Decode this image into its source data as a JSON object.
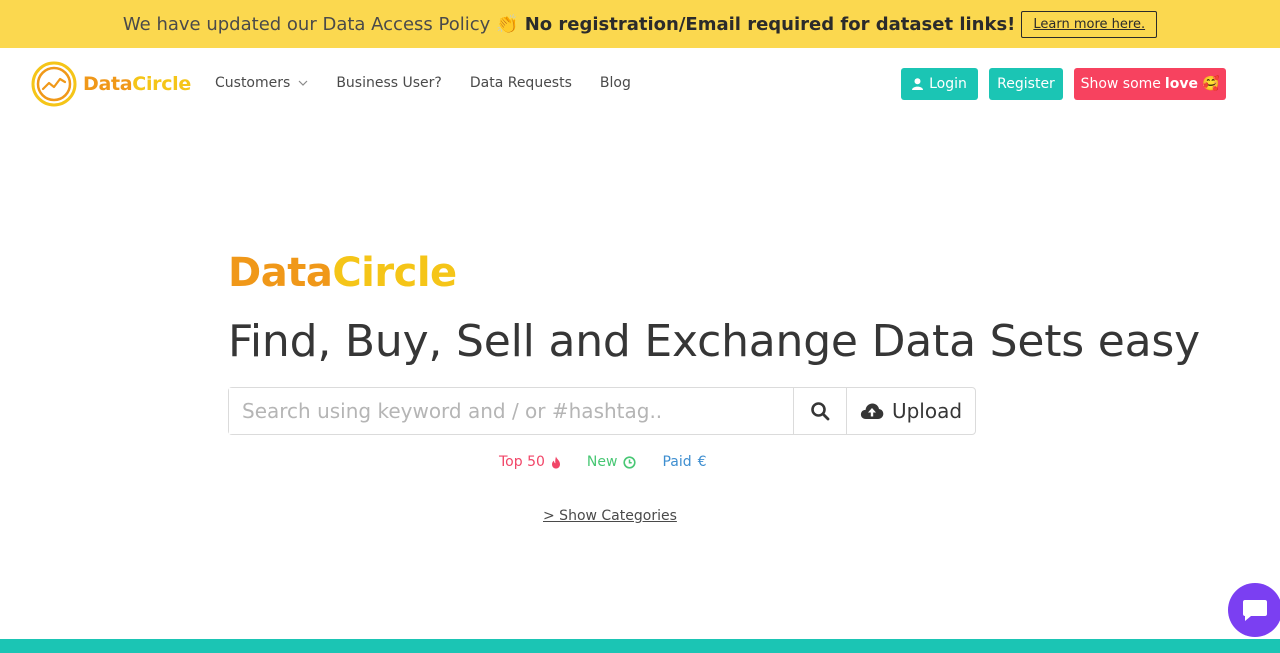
{
  "banner": {
    "text": "We have updated our Data Access Policy",
    "wave_icon": "👏",
    "bold_text": "No registration/Email required for dataset links!",
    "learn_more": "Learn more here."
  },
  "nav": {
    "logo_text_part1": "Data",
    "logo_text_part2": "Circle",
    "menu": [
      {
        "label": "Customers",
        "has_dropdown": true
      },
      {
        "label": "Business User?"
      },
      {
        "label": "Data Requests"
      },
      {
        "label": "Blog"
      }
    ],
    "login_label": "Login",
    "register_label": "Register",
    "love_label": "Show some",
    "love_bold": "love",
    "love_emoji": "🥰"
  },
  "hero": {
    "brand_part1": "Data",
    "brand_part2": "Circle",
    "title": "Find, Buy, Sell and Exchange Data Sets easy",
    "search_placeholder": "Search using keyword and / or #hashtag..",
    "upload_label": "Upload",
    "filters": [
      {
        "label": "Top 50",
        "icon": "🔥"
      },
      {
        "label": "New",
        "icon": "⊙"
      },
      {
        "label": "Paid",
        "icon": "€"
      }
    ],
    "show_categories": "> Show Categories"
  },
  "colors": {
    "banner_bg": "#fbd84f",
    "accent": "#1bc5b4",
    "love": "#f7425f",
    "brand_orange": "#f09819",
    "brand_yellow": "#f5c518",
    "chat": "#7b3ff2"
  }
}
